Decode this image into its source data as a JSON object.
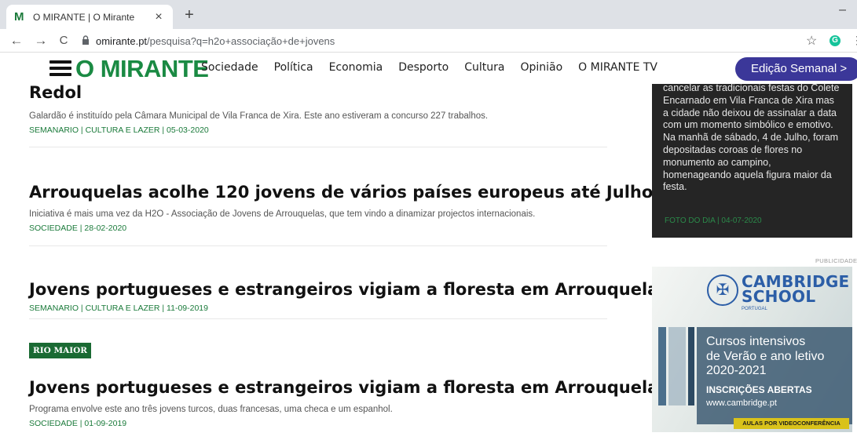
{
  "browser": {
    "tab_title": "O MIRANTE | O Mirante",
    "tab_favicon": "M",
    "tab_close": "×",
    "new_tab": "+",
    "minimize": "–",
    "url_host": "omirante.pt",
    "url_path": "/pesquisa?q=h2o+associação+de+jovens",
    "back_icon": "←",
    "forward_icon": "→",
    "reload_icon": "C",
    "star_icon": "☆"
  },
  "site": {
    "logo": "O MIRANTE",
    "menu": [
      "Sociedade",
      "Política",
      "Economia",
      "Desporto",
      "Cultura",
      "Opinião",
      "O MIRANTE TV"
    ],
    "edition_button": "Edição Semanal  >",
    "accent_color": "#1a8a43",
    "edition_color": "#3b3799"
  },
  "articles": [
    {
      "title": "Redol",
      "description": "Galardão é instituído pela Câmara Municipal de Vila Franca de Xira. Este ano estiveram a concurso 227 trabalhos.",
      "meta": "SEMANARIO | CULTURA E LAZER | 05-03-2020"
    },
    {
      "title": "Arrouquelas acolhe 120 jovens de vários países europeus até Julho",
      "description": "Iniciativa é mais uma vez da H2O - Associação de Jovens de Arrouquelas, que tem vindo a dinamizar projectos internacionais.",
      "meta": "SOCIEDADE | 28-02-2020"
    },
    {
      "title": "Jovens portugueses e estrangeiros vigiam a floresta em Arrouquelas",
      "meta": "SEMANARIO | CULTURA E LAZER | 11-09-2019"
    },
    {
      "tag": "RIO MAIOR",
      "title": "Jovens portugueses e estrangeiros vigiam a floresta em Arrouquelas",
      "description": "Programa envolve este ano três jovens turcos, duas francesas, uma checa e um espanhol.",
      "meta": "SOCIEDADE | 01-09-2019"
    }
  ],
  "sidebar": {
    "photo_text": "cancelar as tradicionais festas do Colete Encarnado em Vila Franca de Xira mas a cidade não deixou de assinalar a data com um momento simbólico e emotivo. Na manhã de sábado, 4 de Julho, foram depositadas coroas de flores no monumento ao campino, homenageando aquela figura maior da festa.",
    "photo_meta": "FOTO DO DIA | 04-07-2020",
    "publicidade": "PUBLICIDADE",
    "ad": {
      "brand_line1": "CAMBRIDGE",
      "brand_line2": "SCHOOL",
      "brand_sub": "PORTUGAL",
      "headline_1": "Cursos intensivos",
      "headline_2": "de Verão e ano letivo",
      "headline_3": "2020-2021",
      "cta": "INSCRIÇÕES ABERTAS",
      "website": "www.cambridge.pt",
      "badge": "AULAS POR VIDEOCONFERÊNCIA"
    }
  }
}
